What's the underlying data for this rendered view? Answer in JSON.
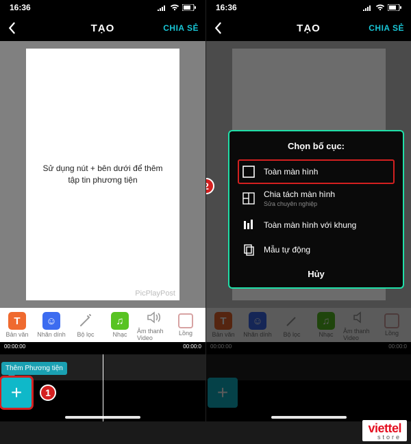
{
  "status": {
    "time": "16:36"
  },
  "nav": {
    "title": "TẠO",
    "share": "CHIA SẺ"
  },
  "canvas": {
    "hint": "Sử dụng nút + bên dưới để thêm tập tin phương tiện",
    "watermark": "PicPlayPost"
  },
  "tools": {
    "text": "Bản văn",
    "sticker": "Nhãn dính",
    "filter": "Bộ lọc",
    "music": "Nhạc",
    "audio": "Âm thanh Video",
    "border": "Lồng"
  },
  "timeline": {
    "start": "00:00:00",
    "end": "00:00:0"
  },
  "tip": {
    "add_media": "Thêm Phương tiện"
  },
  "markers": {
    "one": "1",
    "two": "2"
  },
  "modal": {
    "title": "Chọn bố cục:",
    "cancel": "Hủy",
    "options": {
      "fullscreen": "Toàn màn hình",
      "split": "Chia tách màn hình",
      "split_sub": "Sửa chuyên nghiệp",
      "fullscreen_frame": "Toàn màn hình với khung",
      "auto_template": "Mẫu tự động"
    }
  },
  "brand": {
    "name": "viettel",
    "sub": "store"
  }
}
